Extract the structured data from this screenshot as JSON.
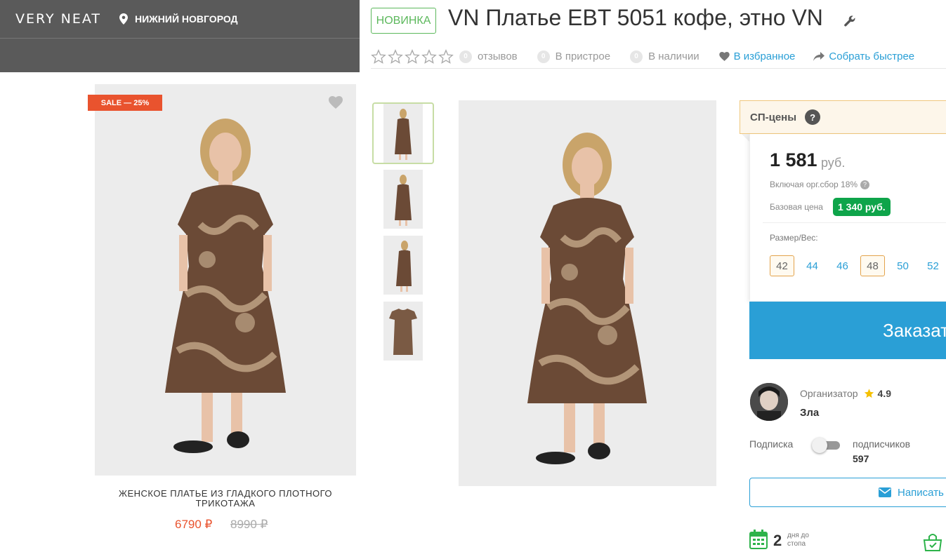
{
  "header": {
    "brand": "VERY NEAT",
    "city": "НИЖНИЙ НОВГОРОД"
  },
  "card": {
    "sale_badge": "SALE — 25%",
    "title": "ЖЕНСКОЕ ПЛАТЬЕ ИЗ ГЛАДКОГО ПЛОТНОГО ТРИКОТАЖА",
    "price": "6790 ₽",
    "old_price": "8990 ₽"
  },
  "product": {
    "new_badge": "НОВИНКА",
    "title": "VN Платье EBT 5051 кофе, этно VN",
    "rating": 0,
    "reviews_count": "0",
    "reviews_label": "отзывов",
    "pristroy_count": "0",
    "pristroy_label": "В пристрое",
    "stock_count": "0",
    "stock_label": "В наличии",
    "favorite_label": "В избранное",
    "faster_label": "Собрать быстрее"
  },
  "price_panel": {
    "header": "СП-цены",
    "help": "?",
    "price": "1 581",
    "currency": "руб.",
    "including": "Включая орг.сбор 18%",
    "base_label": "Базовая цена",
    "base_value": "1 340 руб.",
    "size_label": "Размер/Вес:",
    "sizes": [
      "42",
      "44",
      "46",
      "48",
      "50",
      "52"
    ],
    "selected_sizes": [
      "42",
      "48"
    ],
    "order_button": "Заказать"
  },
  "organizer": {
    "label": "Организатор",
    "rating": "4.9",
    "name": "Зла",
    "subscription_label": "Подписка",
    "subscribers_label": "подписчиков",
    "subscribers_count": "597",
    "write_button": "Написать",
    "days_num": "2",
    "days_label": "дня до стопа"
  },
  "colors": {
    "accent_blue": "#2a9fd6",
    "sale_red": "#e9532e",
    "green": "#0ea44a",
    "banner_gray": "#5a5a5a"
  }
}
